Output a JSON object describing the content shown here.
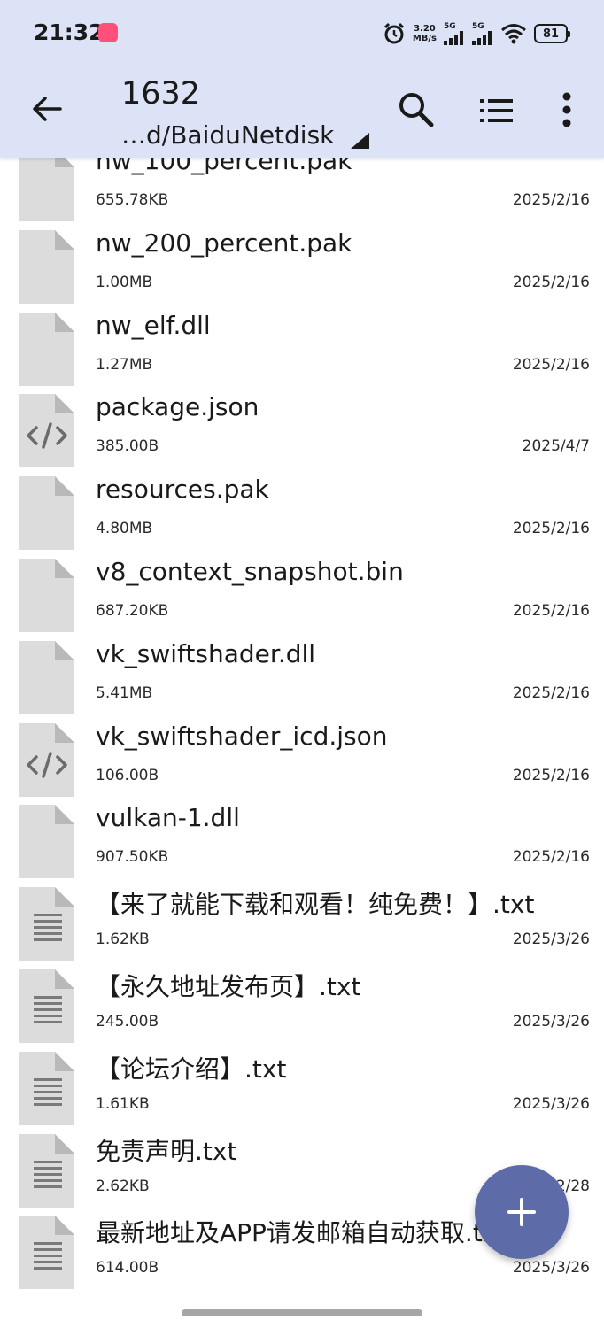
{
  "status_bar": {
    "time": "21:32",
    "net_speed_value": "3.20",
    "net_speed_unit": "MB/s",
    "signal1": "5G",
    "signal2": "5G",
    "battery": "81",
    "icons": [
      "app-badge-icon",
      "alarm-icon",
      "signal-icon",
      "signal-icon",
      "wifi-icon",
      "battery-icon"
    ]
  },
  "toolbar": {
    "title": "1632",
    "path": "…d/BaiduNetdisk",
    "icons": [
      "back-arrow-icon",
      "search-icon",
      "list-view-icon",
      "more-vert-icon"
    ]
  },
  "files": [
    {
      "name": "nw_100_percent.pak",
      "size": "655.78KB",
      "date": "2025/2/16",
      "type": "generic"
    },
    {
      "name": "nw_200_percent.pak",
      "size": "1.00MB",
      "date": "2025/2/16",
      "type": "generic"
    },
    {
      "name": "nw_elf.dll",
      "size": "1.27MB",
      "date": "2025/2/16",
      "type": "generic"
    },
    {
      "name": "package.json",
      "size": "385.00B",
      "date": "2025/4/7",
      "type": "code"
    },
    {
      "name": "resources.pak",
      "size": "4.80MB",
      "date": "2025/2/16",
      "type": "generic"
    },
    {
      "name": "v8_context_snapshot.bin",
      "size": "687.20KB",
      "date": "2025/2/16",
      "type": "generic"
    },
    {
      "name": "vk_swiftshader.dll",
      "size": "5.41MB",
      "date": "2025/2/16",
      "type": "generic"
    },
    {
      "name": "vk_swiftshader_icd.json",
      "size": "106.00B",
      "date": "2025/2/16",
      "type": "code"
    },
    {
      "name": "vulkan-1.dll",
      "size": "907.50KB",
      "date": "2025/2/16",
      "type": "generic"
    },
    {
      "name": "【来了就能下载和观看！纯免费！】.txt",
      "size": "1.62KB",
      "date": "2025/3/26",
      "type": "text"
    },
    {
      "name": "【永久地址发布页】.txt",
      "size": "245.00B",
      "date": "2025/3/26",
      "type": "text"
    },
    {
      "name": "【论坛介绍】.txt",
      "size": "1.61KB",
      "date": "2025/3/26",
      "type": "text"
    },
    {
      "name": "免责声明.txt",
      "size": "2.62KB",
      "date": "2025/2/28",
      "type": "text"
    },
    {
      "name": "最新地址及APP请发邮箱自动获取.txt",
      "size": "614.00B",
      "date": "2025/3/26",
      "type": "text"
    }
  ],
  "fab_icon": "plus-icon",
  "colors": {
    "header_bg": "#dde3f6",
    "fab_bg": "#5d6ca8",
    "icon_gray": "#dcdcdc",
    "icon_dark": "#6b6b6b"
  }
}
